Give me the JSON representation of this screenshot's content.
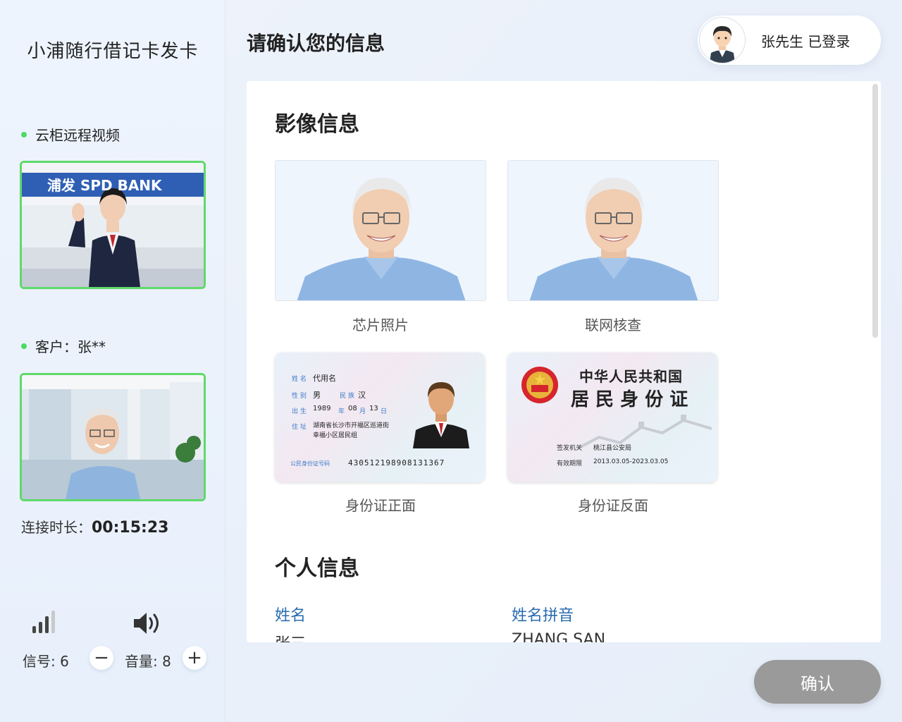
{
  "sidebar": {
    "app_title": "小浦随行借记卡发卡",
    "agent_section_label": "云柜远程视频",
    "customer_section_label": "客户：张**",
    "bank_sign_text": "浦发 SPD BANK",
    "duration_label": "连接时长：",
    "duration_value": "00:15:23",
    "signal_label": "信号: 6",
    "volume_label": "音量: 8",
    "signal_level": 6,
    "volume_level": 8,
    "minus_glyph": "−",
    "plus_glyph": "+"
  },
  "header": {
    "page_title": "请确认您的信息",
    "user_status": "张先生 已登录"
  },
  "panel": {
    "image_section_title": "影像信息",
    "photos": [
      {
        "caption": "芯片照片"
      },
      {
        "caption": "联网核查"
      }
    ],
    "id_front": {
      "caption": "身份证正面",
      "name_label": "姓 名",
      "name_value": "代用名",
      "sex_label": "性 别",
      "sex_value": "男",
      "ethnic_label": "民 族",
      "ethnic_value": "汉",
      "birth_label": "出 生",
      "birth_year": "1989",
      "year_char": "年",
      "birth_month": "08",
      "month_char": "月",
      "birth_day": "13",
      "day_char": "日",
      "addr_label": "住 址",
      "addr_line1": "湖南省长沙市开福区巡道街",
      "addr_line2": "幸福小区居民组",
      "id_label": "公民身份证号码",
      "id_number": "430512198908131367"
    },
    "id_back": {
      "caption": "身份证反面",
      "title_line1": "中华人民共和国",
      "title_line2": "居 民 身 份 证",
      "issuer_label": "签发机关",
      "issuer_value": "桃江县公安局",
      "valid_label": "有效期限",
      "valid_value": "2013.03.05-2023.03.05"
    },
    "personal_section_title": "个人信息",
    "fields": [
      {
        "label": "姓名",
        "value": "张三"
      },
      {
        "label": "姓名拼音",
        "value": "ZHANG SAN"
      }
    ]
  },
  "footer": {
    "confirm_label": "确认"
  },
  "colors": {
    "accent_green": "#5fd96a",
    "field_label_blue": "#2b6cb0",
    "confirm_disabled": "#9a9a9a"
  }
}
